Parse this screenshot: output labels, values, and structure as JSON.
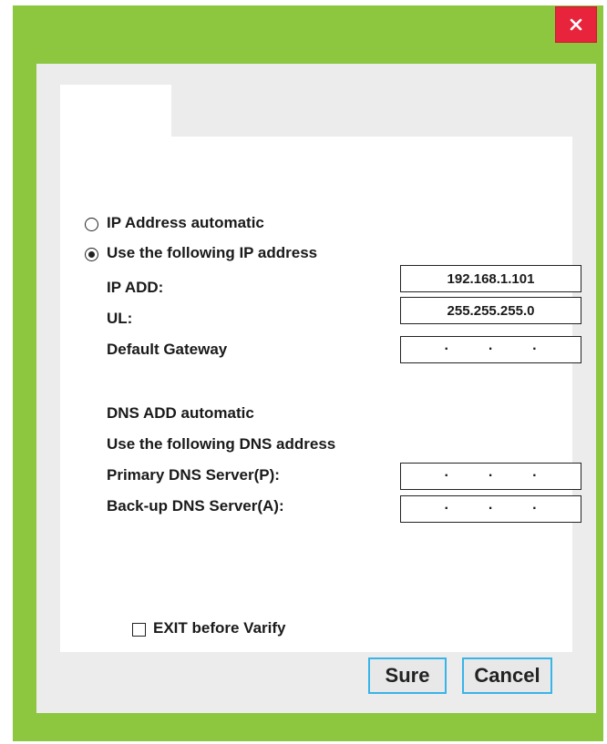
{
  "window": {
    "close_icon": "close-icon"
  },
  "ip": {
    "auto_label": "IP Address automatic",
    "manual_label": "Use the following IP address",
    "selected": "manual",
    "ip_add_label": "IP ADD:",
    "ip_add_value": "192.168.1.101",
    "ul_label": "UL:",
    "ul_value": "255.255.255.0",
    "gateway_label": "Default Gateway",
    "gateway_value": "",
    "dot": "·"
  },
  "dns": {
    "auto_label": "DNS ADD automatic",
    "manual_label": "Use the following DNS address",
    "primary_label": "Primary DNS Server(P):",
    "primary_value": "",
    "backup_label": "Back-up DNS Server(A):",
    "backup_value": ""
  },
  "options": {
    "exit_label": "EXIT before Varify",
    "exit_checked": false
  },
  "buttons": {
    "sure": "Sure",
    "cancel": "Cancel"
  },
  "colors": {
    "frame": "#8dc63f",
    "close_bg": "#e8243c",
    "button_border": "#38b4e8"
  }
}
